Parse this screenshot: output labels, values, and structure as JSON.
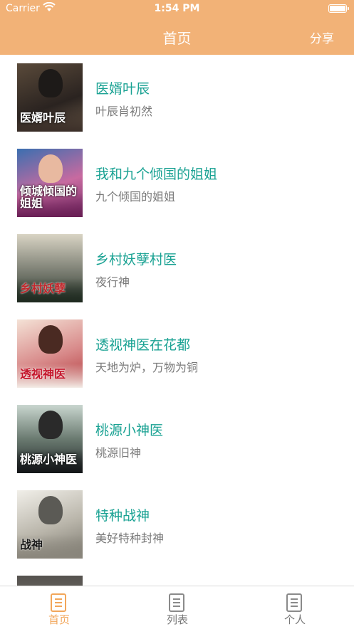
{
  "status_bar": {
    "carrier": "Carrier",
    "time": "1:54 PM"
  },
  "nav": {
    "title": "首页",
    "share_label": "分享"
  },
  "books": [
    {
      "title": "医婿叶辰",
      "author": "叶辰肖初然",
      "cover_text": "医婿叶辰"
    },
    {
      "title": "我和九个倾国的姐姐",
      "author": "九个倾国的姐姐",
      "cover_text": "倾城倾国的姐姐"
    },
    {
      "title": "乡村妖孽村医",
      "author": "夜行神",
      "cover_text": "乡村妖孽"
    },
    {
      "title": "透视神医在花都",
      "author": "天地为炉，万物为铜",
      "cover_text": "透视神医"
    },
    {
      "title": "桃源小神医",
      "author": "桃源旧神",
      "cover_text": "桃源小神医"
    },
    {
      "title": "特种战神",
      "author": "美好特种封神",
      "cover_text": "战神"
    }
  ],
  "tabs": [
    {
      "label": "首页",
      "icon": "list-document-icon",
      "active": true
    },
    {
      "label": "列表",
      "icon": "list-document-icon",
      "active": false
    },
    {
      "label": "个人",
      "icon": "list-document-icon",
      "active": false
    }
  ],
  "colors": {
    "accent": "#F2B277",
    "title_green": "#1AA293",
    "tab_active": "#F2A65A"
  }
}
